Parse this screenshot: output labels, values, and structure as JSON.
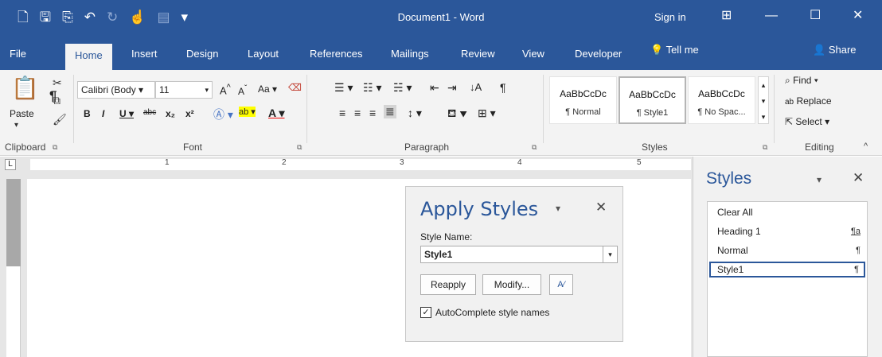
{
  "title_bar": {
    "qat_icons": [
      "new-document-icon",
      "save-icon",
      "save-as-icon",
      "undo-icon",
      "redo-icon",
      "touch-mode-icon",
      "format-icon",
      "customize-qat-icon"
    ],
    "document_title": "Document1  -  Word",
    "sign_in": "Sign in",
    "ribbon_display_icon": "⊞",
    "minimize": "—",
    "restore": "☐",
    "close": "✕"
  },
  "tabs": [
    "File",
    "Home",
    "Insert",
    "Design",
    "Layout",
    "References",
    "Mailings",
    "Review",
    "View",
    "Developer"
  ],
  "active_tab": "Home",
  "tell_me": "Tell me",
  "share": "Share",
  "ribbon": {
    "clipboard": {
      "label": "Clipboard",
      "paste": "Paste"
    },
    "font": {
      "label": "Font",
      "font_name": "Calibri (Body",
      "font_size": "11"
    },
    "paragraph": {
      "label": "Paragraph"
    },
    "styles": {
      "label": "Styles",
      "items": [
        {
          "sample": "AaBbCcDc",
          "name": "¶ Normal"
        },
        {
          "sample": "AaBbCcDc",
          "name": "¶ Style1"
        },
        {
          "sample": "AaBbCcDc",
          "name": "¶ No Spac..."
        }
      ]
    },
    "editing": {
      "label": "Editing",
      "find": "Find",
      "replace": "Replace",
      "select": "Select"
    }
  },
  "ruler": {
    "numbers": [
      "1",
      "2",
      "3",
      "4",
      "5"
    ]
  },
  "document": {
    "paragraph_mark": "¶"
  },
  "apply_styles": {
    "title": "Apply Styles",
    "style_name_label": "Style Name:",
    "style_name_value": "Style1",
    "reapply": "Reapply",
    "modify": "Modify...",
    "autocomplete_label": "AutoComplete style names",
    "autocomplete_checked": true
  },
  "styles_pane": {
    "title": "Styles",
    "items": [
      {
        "name": "Clear All",
        "symbol": ""
      },
      {
        "name": "Heading 1",
        "symbol": "¶a"
      },
      {
        "name": "Normal",
        "symbol": "¶"
      },
      {
        "name": "Style1",
        "symbol": "¶"
      }
    ],
    "selected": "Style1"
  },
  "colors": {
    "accent": "#2b579a",
    "ribbon_bg": "#f3f3f3"
  }
}
